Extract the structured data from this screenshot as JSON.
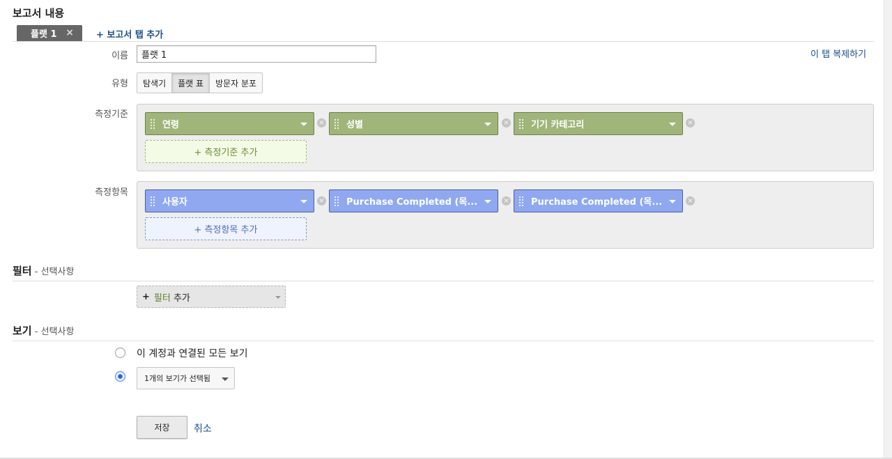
{
  "report_content": {
    "title": "보고서 내용",
    "tab": {
      "label": "플랫 1",
      "close": "×"
    },
    "add_tab": "+ 보고서 탭 추가",
    "name": {
      "label": "이름",
      "value": "플랫 1"
    },
    "duplicate_tab": "이 탭 복제하기",
    "type": {
      "label": "유형",
      "options": [
        "탐색기",
        "플랫 표",
        "방문자 분포"
      ],
      "selected": "플랫 표"
    },
    "dimensions": {
      "label": "측정기준",
      "items": [
        "연령",
        "성별",
        "기기 카테고리"
      ],
      "add": "+ 측정기준 추가"
    },
    "metrics": {
      "label": "측정항목",
      "items": [
        "사용자",
        "Purchase Completed (목...",
        "Purchase Completed (목..."
      ],
      "add": "+ 측정항목 추가"
    }
  },
  "filter": {
    "title": "필터",
    "optional": " - 선택사항",
    "add_plus": "+",
    "add_word": "필터",
    "add_rest": " 추가"
  },
  "view": {
    "title": "보기",
    "optional": " - 선택사항",
    "option_all": "이 계정과 연결된 모든 보기",
    "dropdown_value": "1개의 보기가 선택됨",
    "selected_option": 2
  },
  "actions": {
    "save": "저장",
    "cancel": "취소"
  },
  "colors": {
    "dimension_chip": "#9fb57a",
    "metric_chip": "#8fa8f0",
    "link": "#1a4f8b",
    "tab_bg": "#666666"
  }
}
